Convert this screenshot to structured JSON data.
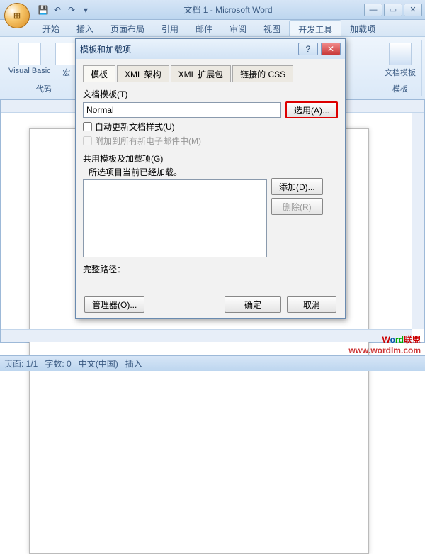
{
  "window": {
    "title": "文档 1 - Microsoft Word",
    "office_logo": "⊞"
  },
  "qat": [
    "💾",
    "↶",
    "↷",
    "▾"
  ],
  "winbtns": {
    "min": "—",
    "max": "▭",
    "close": "✕"
  },
  "tabs": [
    "开始",
    "插入",
    "页面布局",
    "引用",
    "邮件",
    "审阅",
    "视图",
    "开发工具",
    "加载项"
  ],
  "active_tab": "开发工具",
  "ribbon": {
    "group1": {
      "btn": "Visual Basic",
      "label": "代码",
      "macro": "宏"
    },
    "group_last": {
      "btn": "文档模板",
      "label": "模板"
    }
  },
  "dialog": {
    "title": "模板和加载项",
    "help": "?",
    "close": "✕",
    "tabs": [
      "模板",
      "XML 架构",
      "XML 扩展包",
      "链接的 CSS"
    ],
    "active": "模板",
    "doc_template_label": "文档模板(T)",
    "doc_template_value": "Normal",
    "select_btn": "选用(A)...",
    "chk_auto": "自动更新文档样式(U)",
    "chk_attach": "附加到所有新电子邮件中(M)",
    "addins_label": "共用模板及加载项(G)",
    "addins_note": "所选项目当前已经加载。",
    "add_btn": "添加(D)...",
    "remove_btn": "删除(R)",
    "fullpath_label": "完整路径：",
    "manager_btn": "管理器(O)...",
    "ok_btn": "确定",
    "cancel_btn": "取消"
  },
  "status": {
    "page": "页面: 1/1",
    "words": "字数: 0",
    "lang": "中文(中国)",
    "mode": "插入"
  },
  "watermark": {
    "a": "W",
    "b": "o",
    "c": "rd",
    "d": "联盟",
    "url": "www.wordlm.com"
  }
}
